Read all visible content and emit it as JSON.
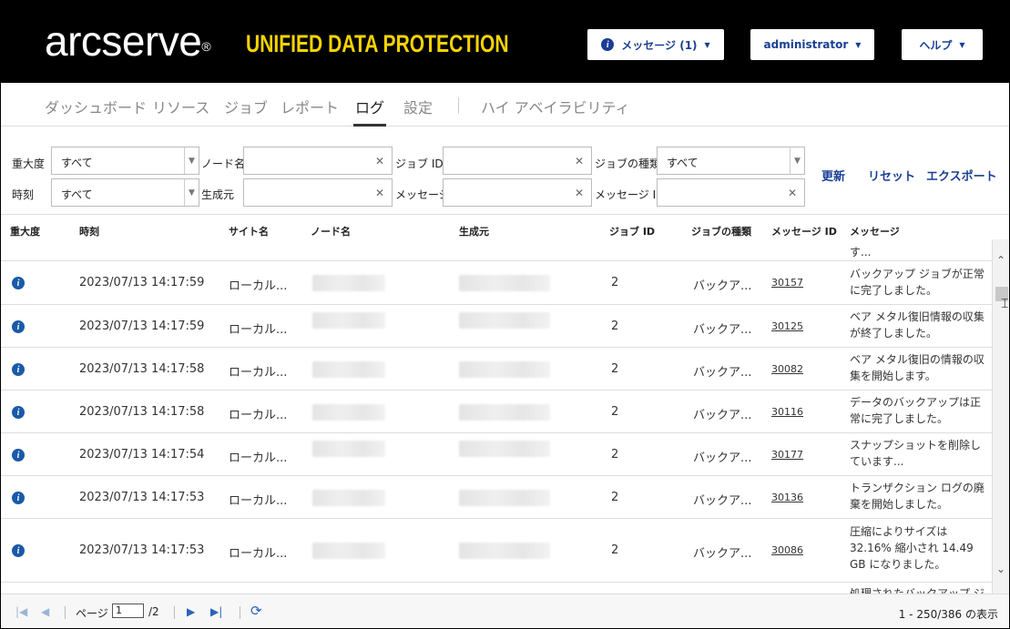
{
  "header": {
    "brand": "arcserve",
    "brand_reg": "®",
    "product": "UNIFIED DATA PROTECTION",
    "messages_label": "メッセージ (1)",
    "user_label": "administrator",
    "help_label": "ヘルプ"
  },
  "nav": {
    "items": [
      "ダッシュボード",
      "リソース",
      "ジョブ",
      "レポート",
      "ログ",
      "設定",
      "ハイ アベイラビリティ"
    ],
    "active": "ログ"
  },
  "filters": {
    "severity_label": "重大度",
    "severity_value": "すべて",
    "node_label": "ノード名",
    "job_id_label": "ジョブ ID",
    "job_type_label": "ジョブの種類",
    "job_type_value": "すべて",
    "time_label": "時刻",
    "time_value": "すべて",
    "source_label": "生成元",
    "message_label": "メッセージ",
    "message_id_label": "メッセージ ID",
    "refresh_label": "更新",
    "reset_label": "リセット",
    "export_label": "エクスポート"
  },
  "table": {
    "columns": [
      "重大度",
      "時刻",
      "サイト名",
      "ノード名",
      "生成元",
      "ジョブ ID",
      "ジョブの種類",
      "メッセージ ID",
      "メッセージ"
    ],
    "partial_message": "す...",
    "rows": [
      {
        "time": "2023/07/13 14:17:59",
        "site": "ローカル...",
        "job_id": "2",
        "job_type": "バックア...",
        "msg_id": "30157",
        "msg": "バックアップ ジョブが正常に完了しました。"
      },
      {
        "time": "2023/07/13 14:17:59",
        "site": "ローカル...",
        "job_id": "2",
        "job_type": "バックア...",
        "msg_id": "30125",
        "msg": "ベア メタル復旧情報の収集が終了しました。"
      },
      {
        "time": "2023/07/13 14:17:58",
        "site": "ローカル...",
        "job_id": "2",
        "job_type": "バックア...",
        "msg_id": "30082",
        "msg": "ベア メタル復旧の情報の収集を開始します。"
      },
      {
        "time": "2023/07/13 14:17:58",
        "site": "ローカル...",
        "job_id": "2",
        "job_type": "バックア...",
        "msg_id": "30116",
        "msg": "データのバックアップは正常に完了しました。"
      },
      {
        "time": "2023/07/13 14:17:54",
        "site": "ローカル...",
        "job_id": "2",
        "job_type": "バックア...",
        "msg_id": "30177",
        "msg": "スナップショットを削除しています..."
      },
      {
        "time": "2023/07/13 14:17:53",
        "site": "ローカル...",
        "job_id": "2",
        "job_type": "バックア...",
        "msg_id": "30136",
        "msg": "トランザクション ログの廃棄を開始しました。"
      },
      {
        "time": "2023/07/13 14:17:53",
        "site": "ローカル...",
        "job_id": "2",
        "job_type": "バックア...",
        "msg_id": "30086",
        "msg": "圧縮によりサイズは 32.16% 縮小され 14.49 GB になりました。"
      }
    ],
    "trailing_message": "処理されたバックアップ ジョ..."
  },
  "pager": {
    "page_label": "ページ",
    "page_value": "1",
    "page_total": "/2",
    "summary": "1 - 250/386 の表示"
  }
}
